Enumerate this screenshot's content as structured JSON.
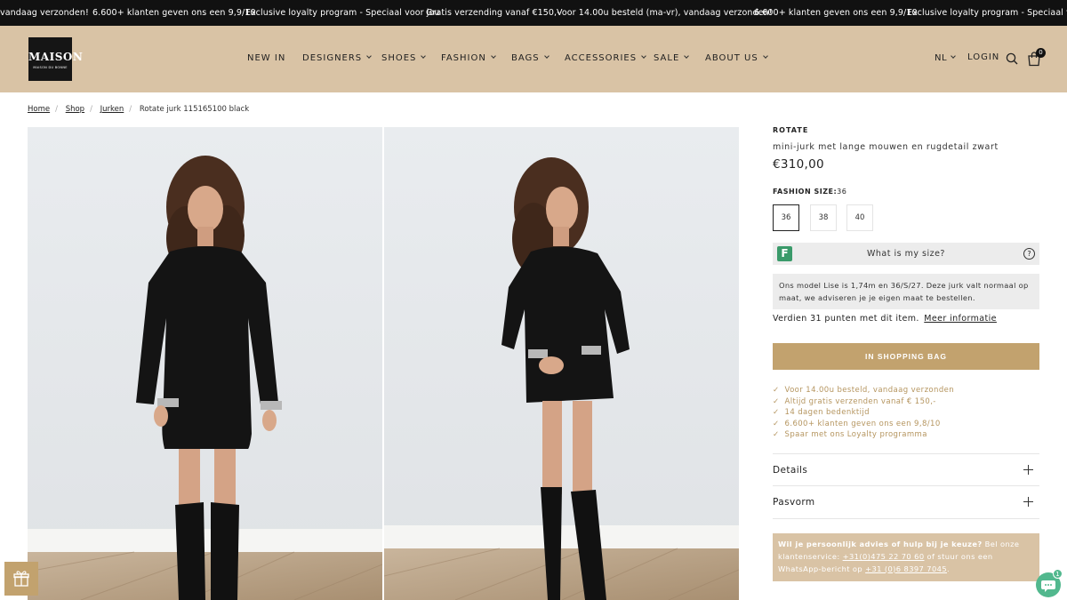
{
  "announcement_bar": {
    "messages": [
      "vandaag verzonden!",
      "6.600+ klanten geven ons een 9,9/10",
      "Exclusive loyalty program - Speciaal voor jou",
      "Gratis verzending vanaf €150,-",
      "Voor 14.00u besteld (ma-vr), vandaag verzonden!",
      "6.600+ klanten geven ons een 9,9/10",
      "Exclusive loyalty program - Speciaal voor jou"
    ]
  },
  "header": {
    "logo": {
      "text": "MAISON",
      "tagline": "MAISON DU BONNE"
    },
    "nav": [
      {
        "label": "NEW IN",
        "dropdown": false
      },
      {
        "label": "DESIGNERS",
        "dropdown": true
      },
      {
        "label": "SHOES",
        "dropdown": true
      },
      {
        "label": "FASHION",
        "dropdown": true
      },
      {
        "label": "BAGS",
        "dropdown": true
      },
      {
        "label": "ACCESSORIES",
        "dropdown": true
      },
      {
        "label": "SALE",
        "dropdown": true
      },
      {
        "label": "ABOUT US",
        "dropdown": true
      }
    ],
    "language": "NL",
    "login_label": "LOGIN",
    "cart_count": "0",
    "icons": {
      "search": "search-icon",
      "cart": "shopping-bag-icon"
    },
    "background": "#d9c3a5"
  },
  "breadcrumb": {
    "items": [
      "Home",
      "Shop",
      "Jurken"
    ],
    "current": "Rotate jurk 115165100 black"
  },
  "product": {
    "brand": "ROTATE",
    "subtitle": "mini-jurk met lange mouwen en rugdetail zwart",
    "price": "€310,00",
    "size_label": "FASHION SIZE:",
    "selected_size": "36",
    "sizes": [
      "36",
      "38",
      "40"
    ],
    "fit_finder": {
      "logo_letter": "F",
      "text": "What is my size?",
      "help": "?"
    },
    "model_note": "Ons model Lise is 1,74m en 36/S/27. Deze jurk valt normaal op maat, we adviseren je je eigen maat te bestellen.",
    "points_text": "Verdien 31 punten met dit item.",
    "points_link": "Meer informatie",
    "add_to_cart_label": "IN SHOPPING BAG",
    "usps": [
      "Voor 14.00u besteld, vandaag verzonden",
      "Altijd gratis verzenden vanaf € 150,-",
      "14 dagen bedenktijd",
      "6.600+ klanten geven ons een 9,8/10",
      "Spaar met ons Loyalty programma"
    ],
    "usp_check": "✓",
    "accordions": [
      "Details",
      "Pasvorm"
    ]
  },
  "help_box": {
    "lead": "Wil je persoonlijk advies of hulp bij je keuze?",
    "text1": " Bel onze klantenservice: ",
    "phone": "+31(0)475 22 70 60",
    "text2": " of stuur ons een WhatsApp-bericht op ",
    "whatsapp": "+31 (0)6 8397 7045",
    "text3": "."
  },
  "widgets": {
    "chat_badge": "1"
  },
  "colors": {
    "accent": "#c2a26e",
    "header": "#d9c3a5",
    "usp": "#b5955f"
  }
}
